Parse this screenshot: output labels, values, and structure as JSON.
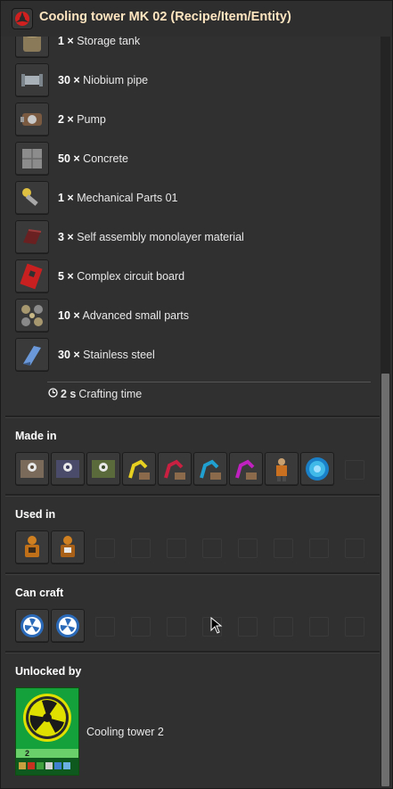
{
  "window": {
    "title": "Cooling tower MK 02 (Recipe/Item/Entity)",
    "title_icon": "cooling-tower-icon"
  },
  "ingredients": [
    {
      "count": "1 ×",
      "name": "Storage tank",
      "icon": "storage-tank-icon"
    },
    {
      "count": "30 ×",
      "name": "Niobium pipe",
      "icon": "niobium-pipe-icon"
    },
    {
      "count": "2 ×",
      "name": "Pump",
      "icon": "pump-icon"
    },
    {
      "count": "50 ×",
      "name": "Concrete",
      "icon": "concrete-icon"
    },
    {
      "count": "1 ×",
      "name": "Mechanical Parts 01",
      "icon": "mechanical-parts-icon"
    },
    {
      "count": "3 ×",
      "name": "Self assembly monolayer material",
      "icon": "monolayer-material-icon"
    },
    {
      "count": "5 ×",
      "name": "Complex circuit board",
      "icon": "circuit-board-icon"
    },
    {
      "count": "10 ×",
      "name": "Advanced small parts",
      "icon": "small-parts-icon"
    },
    {
      "count": "30 ×",
      "name": "Stainless steel",
      "icon": "stainless-steel-icon"
    }
  ],
  "crafting_time": {
    "value": "2 s",
    "label": "Crafting time",
    "icon": "clock-icon"
  },
  "made_in": {
    "title": "Made in",
    "items": [
      "assembler-1-icon",
      "assembler-2-icon",
      "assembler-3-icon",
      "robot-arm-yellow-icon",
      "robot-arm-red-icon",
      "robot-arm-blue-icon",
      "robot-arm-purple-icon",
      "character-icon",
      "portal-icon"
    ]
  },
  "used_in": {
    "title": "Used in",
    "items": [
      "armor-suit-icon",
      "armor-suit-2-icon"
    ]
  },
  "can_craft": {
    "title": "Can craft",
    "items": [
      "fan-icon",
      "fan-icon"
    ]
  },
  "unlocked_by": {
    "title": "Unlocked by",
    "tech_name": "Cooling tower 2",
    "tech_level": "2",
    "icon": "cooling-fan-technology-icon"
  },
  "colors": {
    "title": "#ffe6c0",
    "panel": "#313031",
    "slot": "#3a3a3a",
    "tech_green": "#1e7a1e",
    "tech_yellow": "#e0e000"
  }
}
